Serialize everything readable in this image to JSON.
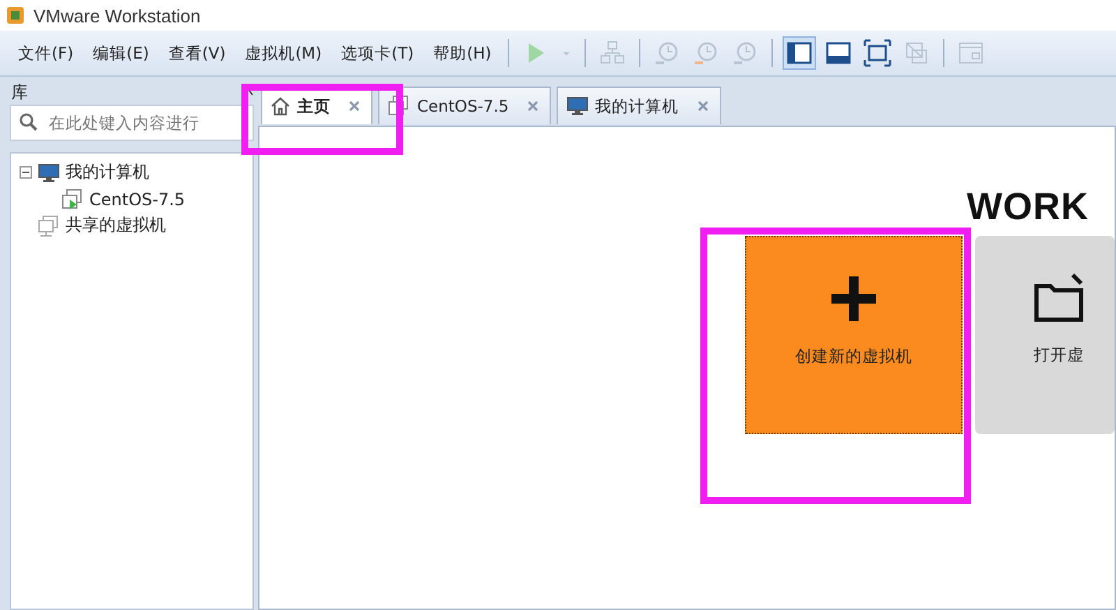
{
  "window": {
    "title": "VMware Workstation"
  },
  "menu": [
    "文件(F)",
    "编辑(E)",
    "查看(V)",
    "虚拟机(M)",
    "选项卡(T)",
    "帮助(H)"
  ],
  "toolbar": [
    {
      "kind": "play",
      "disabled": true,
      "selected": false
    },
    {
      "kind": "caret",
      "disabled": true,
      "selected": false
    },
    {
      "kind": "sep"
    },
    {
      "kind": "network",
      "disabled": true,
      "selected": false
    },
    {
      "kind": "sep"
    },
    {
      "kind": "snapshot",
      "disabled": true,
      "selected": false
    },
    {
      "kind": "revert",
      "disabled": true,
      "selected": false
    },
    {
      "kind": "manager",
      "disabled": true,
      "selected": false
    },
    {
      "kind": "sep"
    },
    {
      "kind": "library",
      "disabled": false,
      "selected": true
    },
    {
      "kind": "thumbnail",
      "disabled": false,
      "selected": false
    },
    {
      "kind": "fullscreen",
      "disabled": false,
      "selected": false
    },
    {
      "kind": "unity",
      "disabled": true,
      "selected": false
    },
    {
      "kind": "sep"
    },
    {
      "kind": "console",
      "disabled": true,
      "selected": false
    }
  ],
  "library": {
    "title": "库",
    "search": {
      "placeholder": "在此处键入内容进行"
    },
    "tree": [
      {
        "label": "我的计算机",
        "kind": "computer",
        "expanded": true,
        "children": [
          {
            "label": "CentOS-7.5",
            "kind": "vm"
          }
        ]
      },
      {
        "label": "共享的虚拟机",
        "kind": "shared"
      }
    ]
  },
  "tabs": [
    {
      "label": "主页",
      "kind": "home",
      "selected": true
    },
    {
      "label": "CentOS-7.5",
      "kind": "vm",
      "selected": false
    },
    {
      "label": "我的计算机",
      "kind": "computer",
      "selected": false
    }
  ],
  "home": {
    "heading": "WORK",
    "cards": [
      {
        "label": "创建新的虚拟机",
        "kind": "create"
      },
      {
        "label": "打开虚",
        "kind": "open"
      }
    ]
  }
}
